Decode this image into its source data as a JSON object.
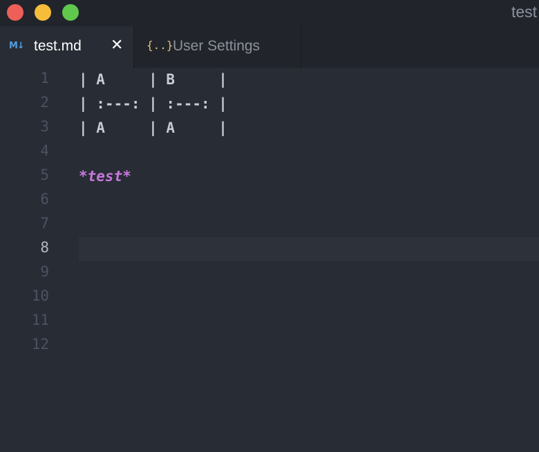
{
  "window": {
    "title": "test"
  },
  "tabs": [
    {
      "icon": "markdown-icon",
      "icon_text": "M↓",
      "label": "test.md",
      "close_glyph": "✕",
      "active": true
    },
    {
      "icon": "json-braces-icon",
      "icon_text": "{..}",
      "label": "User Settings",
      "active": false
    }
  ],
  "editor": {
    "current_line": 8,
    "lines": [
      {
        "num": "1",
        "text": "| A     | B     |"
      },
      {
        "num": "2",
        "text": "| :---: | :---: |"
      },
      {
        "num": "3",
        "text": "| A     | A     |"
      },
      {
        "num": "4",
        "text": ""
      },
      {
        "num": "5",
        "text": "*test*"
      },
      {
        "num": "6",
        "text": ""
      },
      {
        "num": "7",
        "text": ""
      },
      {
        "num": "8",
        "text": ""
      },
      {
        "num": "9",
        "text": ""
      },
      {
        "num": "10",
        "text": ""
      },
      {
        "num": "11",
        "text": ""
      },
      {
        "num": "12",
        "text": ""
      }
    ]
  },
  "colors": {
    "background": "#282c34",
    "chrome": "#21252b",
    "emphasis": "#c678dd",
    "markdown_icon": "#4f9ee0",
    "json_icon": "#e5c07b"
  }
}
